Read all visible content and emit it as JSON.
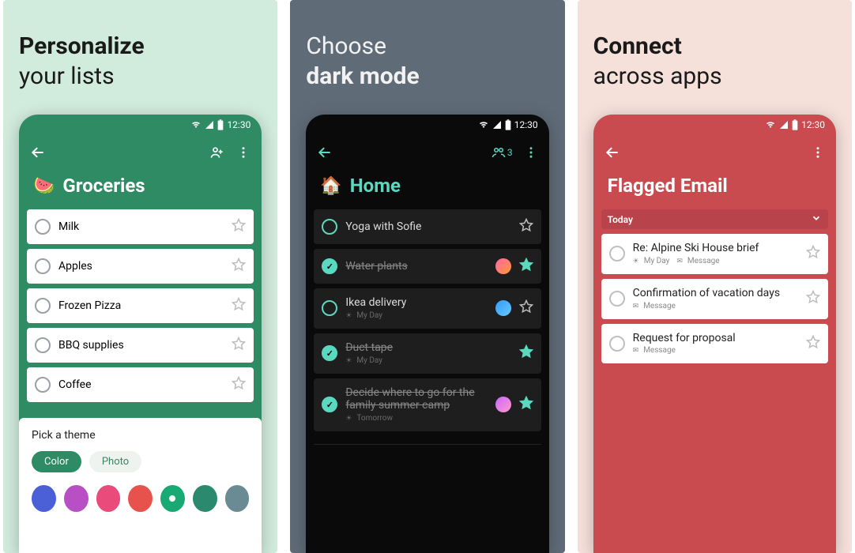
{
  "panel1": {
    "headline_bold": "Personalize",
    "headline_rest": "your lists",
    "status_time": "12:30",
    "list_emoji": "🍉",
    "list_title": "Groceries",
    "tasks": [
      {
        "title": "Milk"
      },
      {
        "title": "Apples"
      },
      {
        "title": "Frozen Pizza"
      },
      {
        "title": "BBQ supplies"
      },
      {
        "title": "Coffee"
      }
    ],
    "theme_title": "Pick a theme",
    "pill_color": "Color",
    "pill_photo": "Photo",
    "colors": [
      "#4b5fd6",
      "#b94fc4",
      "#e94b7a",
      "#e8524c",
      "#19a974",
      "#2b8a6e",
      "#6a8b94"
    ],
    "selected_color_index": 4
  },
  "panel2": {
    "headline_bold": "dark mode",
    "headline_rest": "Choose",
    "status_time": "12:30",
    "share_count": "3",
    "list_emoji": "🏠",
    "list_title": "Home",
    "tasks": [
      {
        "title": "Yoga with Sofie",
        "done": false,
        "star": false,
        "avatar": ""
      },
      {
        "title": "Water plants",
        "done": true,
        "star": true,
        "avatar": "av1"
      },
      {
        "title": "Ikea delivery",
        "done": false,
        "star": false,
        "avatar": "av2",
        "sub": "My Day"
      },
      {
        "title": "Duct tape",
        "done": true,
        "star": true,
        "sub": "My Day"
      },
      {
        "title": "Decide where to go for the family summer camp",
        "done": true,
        "star": true,
        "avatar": "av3",
        "sub": "Tomorrow"
      }
    ]
  },
  "panel3": {
    "headline_bold": "Connect",
    "headline_rest": "across apps",
    "status_time": "12:30",
    "list_title": "Flagged Email",
    "section": "Today",
    "tasks": [
      {
        "title": "Re: Alpine Ski House brief",
        "sub1": "My Day",
        "sub2": "Message"
      },
      {
        "title": "Confirmation of vacation days",
        "sub2": "Message"
      },
      {
        "title": "Request for proposal",
        "sub2": "Message"
      }
    ]
  }
}
